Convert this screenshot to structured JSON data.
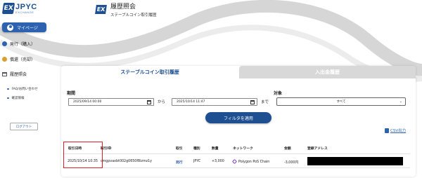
{
  "brand": {
    "logo_mark": "EX",
    "logo_main": "JPYC",
    "logo_sub": "EXCHANGE"
  },
  "sidebar": {
    "mypage_label": "マイページ",
    "items": [
      {
        "label": "発行（購入）",
        "icon": "issue-icon"
      },
      {
        "label": "償還（売却）",
        "icon": "redeem-icon"
      },
      {
        "label": "履歴照会",
        "icon": "history-icon"
      }
    ],
    "sub_items": [
      {
        "label": "FAQ/お問い合わせ"
      },
      {
        "label": "確認情報"
      }
    ],
    "logout_label": "ログアウト"
  },
  "header": {
    "mark": "EX",
    "title": "履歴照会",
    "subtitle": "ステーブルコイン取引履歴"
  },
  "tabs": [
    {
      "label": "ステーブルコイン取引履歴",
      "active": true
    },
    {
      "label": "入出金履歴",
      "active": false
    }
  ],
  "filter": {
    "period_label": "期間",
    "from_value": "2025/09/14 00:00",
    "from_sep": "から",
    "to_value": "2025/10/14 11:47",
    "to_sep": "まで",
    "target_label": "対象",
    "target_value": "すべて",
    "apply_label": "フィルタを適用"
  },
  "csv_label": "CSV出力",
  "table": {
    "headers": [
      "取引日時",
      "取引ID",
      "取引",
      "種別",
      "数量",
      "ネットワーク",
      "金額",
      "登録アドレス"
    ],
    "rows": [
      {
        "datetime": "2025/10/14 10:35",
        "id": "cmgpvaxbt002g0650f8izmz1y",
        "type": "発行",
        "kind": "JPYC",
        "amount": "+3,000",
        "network": "Polygon PoS Chain",
        "price": "-3,000円"
      }
    ]
  },
  "colors": {
    "brand_blue": "#1d4f91",
    "accent_blue": "#2d62b0",
    "highlight": "#e02020"
  }
}
